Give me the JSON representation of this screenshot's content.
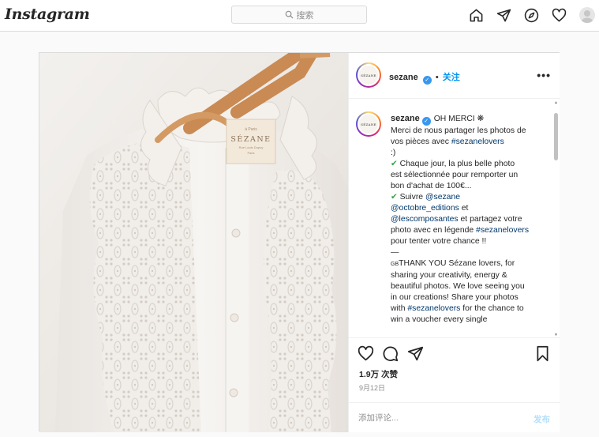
{
  "topnav": {
    "logo": "Instagram",
    "search_placeholder": "搜索"
  },
  "post": {
    "brand_mark": "SÉZANE",
    "author": "sezane",
    "follow_label": "关注",
    "more_label": "•••",
    "hanger_tag": {
      "line1": "à Paris",
      "brand": "SÉZANE",
      "line2": "Rue Louis Dupuy",
      "line3": "Paris"
    },
    "caption_lines": [
      {
        "kind": "header",
        "author": "sezane",
        "text": "OH MERCI ❋"
      },
      {
        "parts": [
          {
            "t": "Merci de nous partager les photos de"
          }
        ]
      },
      {
        "parts": [
          {
            "t": "vos pièces avec "
          },
          {
            "t": "#sezanelovers",
            "tag": true
          }
        ]
      },
      {
        "parts": [
          {
            "t": ":)"
          }
        ]
      },
      {
        "parts": [
          {
            "t": "✔",
            "check": true
          },
          {
            "t": " Chaque jour, la plus belle photo"
          }
        ]
      },
      {
        "parts": [
          {
            "t": "est sélectionnée pour remporter un"
          }
        ]
      },
      {
        "parts": [
          {
            "t": "bon d'achat de 100€..."
          }
        ]
      },
      {
        "parts": [
          {
            "t": "✔",
            "check": true
          },
          {
            "t": " Suivre "
          },
          {
            "t": "@sezane",
            "tag": true
          }
        ]
      },
      {
        "parts": [
          {
            "t": "@octobre_editions",
            "tag": true
          },
          {
            "t": " et"
          }
        ]
      },
      {
        "parts": [
          {
            "t": "@lescomposantes",
            "tag": true
          },
          {
            "t": " et partagez votre"
          }
        ]
      },
      {
        "parts": [
          {
            "t": "photo avec en légende "
          },
          {
            "t": "#sezanelovers",
            "tag": true
          }
        ]
      },
      {
        "parts": [
          {
            "t": "pour tenter votre chance !!"
          }
        ]
      },
      {
        "parts": [
          {
            "t": " "
          }
        ]
      },
      {
        "parts": [
          {
            "t": "—"
          }
        ]
      },
      {
        "parts": [
          {
            "t": "GB",
            "small": true
          },
          {
            "t": "THANK YOU Sézane lovers, for"
          }
        ]
      },
      {
        "parts": [
          {
            "t": "sharing your creativity, energy &"
          }
        ]
      },
      {
        "parts": [
          {
            "t": "beautiful photos. We love seeing you"
          }
        ]
      },
      {
        "parts": [
          {
            "t": "in our creations! Share your photos"
          }
        ]
      },
      {
        "parts": [
          {
            "t": "with "
          },
          {
            "t": "#sezanelovers",
            "tag": true
          },
          {
            "t": " for the chance to"
          }
        ]
      },
      {
        "parts": [
          {
            "t": "win a voucher every single"
          }
        ]
      }
    ],
    "likes": "1.9万 次赞",
    "date": "9月12日",
    "comment_placeholder": "添加评论...",
    "post_label": "发布"
  },
  "colors": {
    "accent": "#0095f6",
    "tag_link": "#00376b",
    "verified": "#3897f0",
    "check_green": "#37a34a"
  },
  "icons": {
    "nav": [
      "home-icon",
      "direct-icon",
      "explore-icon",
      "heart-icon"
    ],
    "actions": [
      "like-icon",
      "comment-icon",
      "share-icon",
      "save-icon"
    ]
  }
}
